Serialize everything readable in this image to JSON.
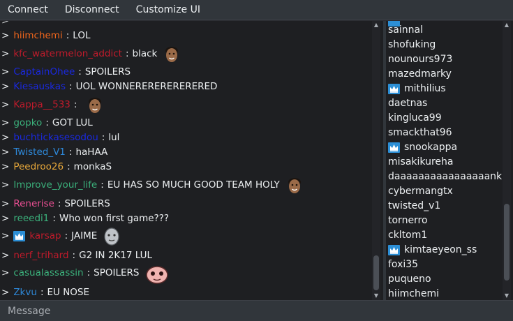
{
  "menu": {
    "connect": "Connect",
    "disconnect": "Disconnect",
    "customize": "Customize UI"
  },
  "chat": {
    "arrow": ">",
    "separator": ":",
    "messages": [
      {
        "user": "hiimchemi",
        "color": "#f2661c",
        "text": "LOL"
      },
      {
        "user": "kfc_watermelon_addict",
        "color": "#c01b2b",
        "text": "black",
        "emote": "face-emote"
      },
      {
        "user": "CaptainOhee",
        "color": "#1a29e0",
        "text": "SPOILERS"
      },
      {
        "user": "Kiesauskas",
        "color": "#1a29e0",
        "text": "UOL WONNERERERERERERED"
      },
      {
        "user": "Kappa__533",
        "color": "#c01b2b",
        "text": "",
        "emote": "face-emote"
      },
      {
        "user": "gopko",
        "color": "#3bb07b",
        "text": "GOT LUL"
      },
      {
        "user": "buchtickasesodou",
        "color": "#1a29e0",
        "text": "lul"
      },
      {
        "user": "Twisted_V1",
        "color": "#2e88d8",
        "text": "haHAA"
      },
      {
        "user": "Peedroo26",
        "color": "#e8a83a",
        "text": "monkaS"
      },
      {
        "user": "Improve_your_life",
        "color": "#3bb07b",
        "text": "EU HAS SO MUCH GOOD TEAM HOLY",
        "emote": "face-emote"
      },
      {
        "user": "Renerise",
        "color": "#ea4f93",
        "text": "SPOILERS"
      },
      {
        "user": "reeedi1",
        "color": "#3bb07b",
        "text": "Who won first game???"
      },
      {
        "user": "karsap",
        "color": "#c01b2b",
        "text": "JAIME",
        "badge": true,
        "emote": "grey-face-emote"
      },
      {
        "user": "nerf_trihard",
        "color": "#c01b2b",
        "text": "G2 IN 2K17 LUL"
      },
      {
        "user": "casualassassin",
        "color": "#3bb07b",
        "text": "SPOILERS",
        "emote": "pink-blob-emote"
      },
      {
        "user": "Zkvu",
        "color": "#2e88d8",
        "text": "EU NOSE"
      }
    ]
  },
  "users": [
    {
      "name": "sainnal"
    },
    {
      "name": "shofuking"
    },
    {
      "name": "nounours973"
    },
    {
      "name": "mazedmarky"
    },
    {
      "name": "mithilius",
      "badge": true
    },
    {
      "name": "daetnas"
    },
    {
      "name": "kingluca99"
    },
    {
      "name": "smackthat96"
    },
    {
      "name": "snookappa",
      "badge": true
    },
    {
      "name": "misakikureha"
    },
    {
      "name": "daaaaaaaaaaaaaaaankn"
    },
    {
      "name": "cybermangtx"
    },
    {
      "name": "twisted_v1"
    },
    {
      "name": "tornerro"
    },
    {
      "name": "ckltom1"
    },
    {
      "name": "kimtaeyeon_ss",
      "badge": true
    },
    {
      "name": "foxi35"
    },
    {
      "name": "puqueno"
    },
    {
      "name": "hiimchemi"
    }
  ],
  "input": {
    "placeholder": "Message"
  },
  "colors": {
    "badge": "#2c8fd6",
    "background": "#1e1f22",
    "chrome": "#31363b"
  }
}
